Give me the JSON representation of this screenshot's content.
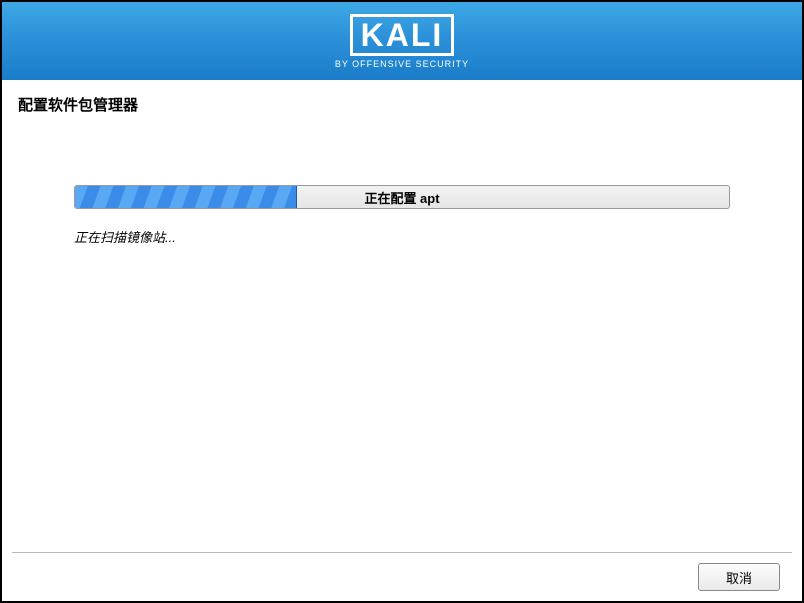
{
  "header": {
    "logo_text": "KALI",
    "logo_subtitle": "BY OFFENSIVE SECURITY"
  },
  "section_title": "配置软件包管理器",
  "progress": {
    "label": "正在配置 apt",
    "percent": 34,
    "status": "正在扫描镜像站..."
  },
  "buttons": {
    "cancel": "取消"
  }
}
